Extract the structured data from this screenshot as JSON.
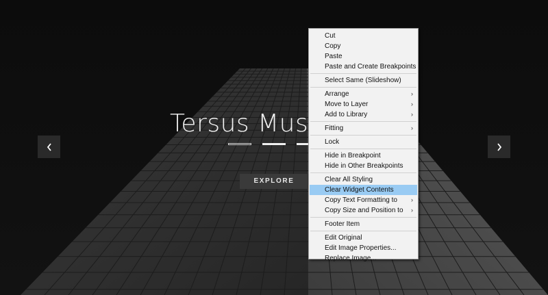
{
  "slide": {
    "title": "Tersus Muse",
    "explore_label": "EXPLORE",
    "prev_icon": "chevron-left-icon",
    "next_icon": "chevron-right-icon",
    "active_indicator": 1
  },
  "context_menu": {
    "groups": [
      [
        {
          "label": "Cut",
          "submenu": false
        },
        {
          "label": "Copy",
          "submenu": false
        },
        {
          "label": "Paste",
          "submenu": false
        },
        {
          "label": "Paste and Create Breakpoints",
          "submenu": false
        }
      ],
      [
        {
          "label": "Select Same (Slideshow)",
          "submenu": false
        }
      ],
      [
        {
          "label": "Arrange",
          "submenu": true
        },
        {
          "label": "Move to Layer",
          "submenu": true
        },
        {
          "label": "Add to Library",
          "submenu": true
        }
      ],
      [
        {
          "label": "Fitting",
          "submenu": true
        }
      ],
      [
        {
          "label": "Lock",
          "submenu": false
        }
      ],
      [
        {
          "label": "Hide in Breakpoint",
          "submenu": false
        },
        {
          "label": "Hide in Other Breakpoints",
          "submenu": false
        }
      ],
      [
        {
          "label": "Clear All Styling",
          "submenu": false
        },
        {
          "label": "Clear Widget Contents",
          "submenu": false,
          "highlighted": true
        },
        {
          "label": "Copy Text Formatting to",
          "submenu": true
        },
        {
          "label": "Copy Size and Position to",
          "submenu": true
        }
      ],
      [
        {
          "label": "Footer Item",
          "submenu": false
        }
      ],
      [
        {
          "label": "Edit Original",
          "submenu": false
        },
        {
          "label": "Edit Image Properties...",
          "submenu": false
        },
        {
          "label": "Replace Image...",
          "submenu": false
        }
      ]
    ],
    "submenu_arrow": "›"
  },
  "colors": {
    "menu_highlight": "#99cbf3",
    "menu_background": "#f2f2f2",
    "slide_background": "#0b0b0b"
  }
}
